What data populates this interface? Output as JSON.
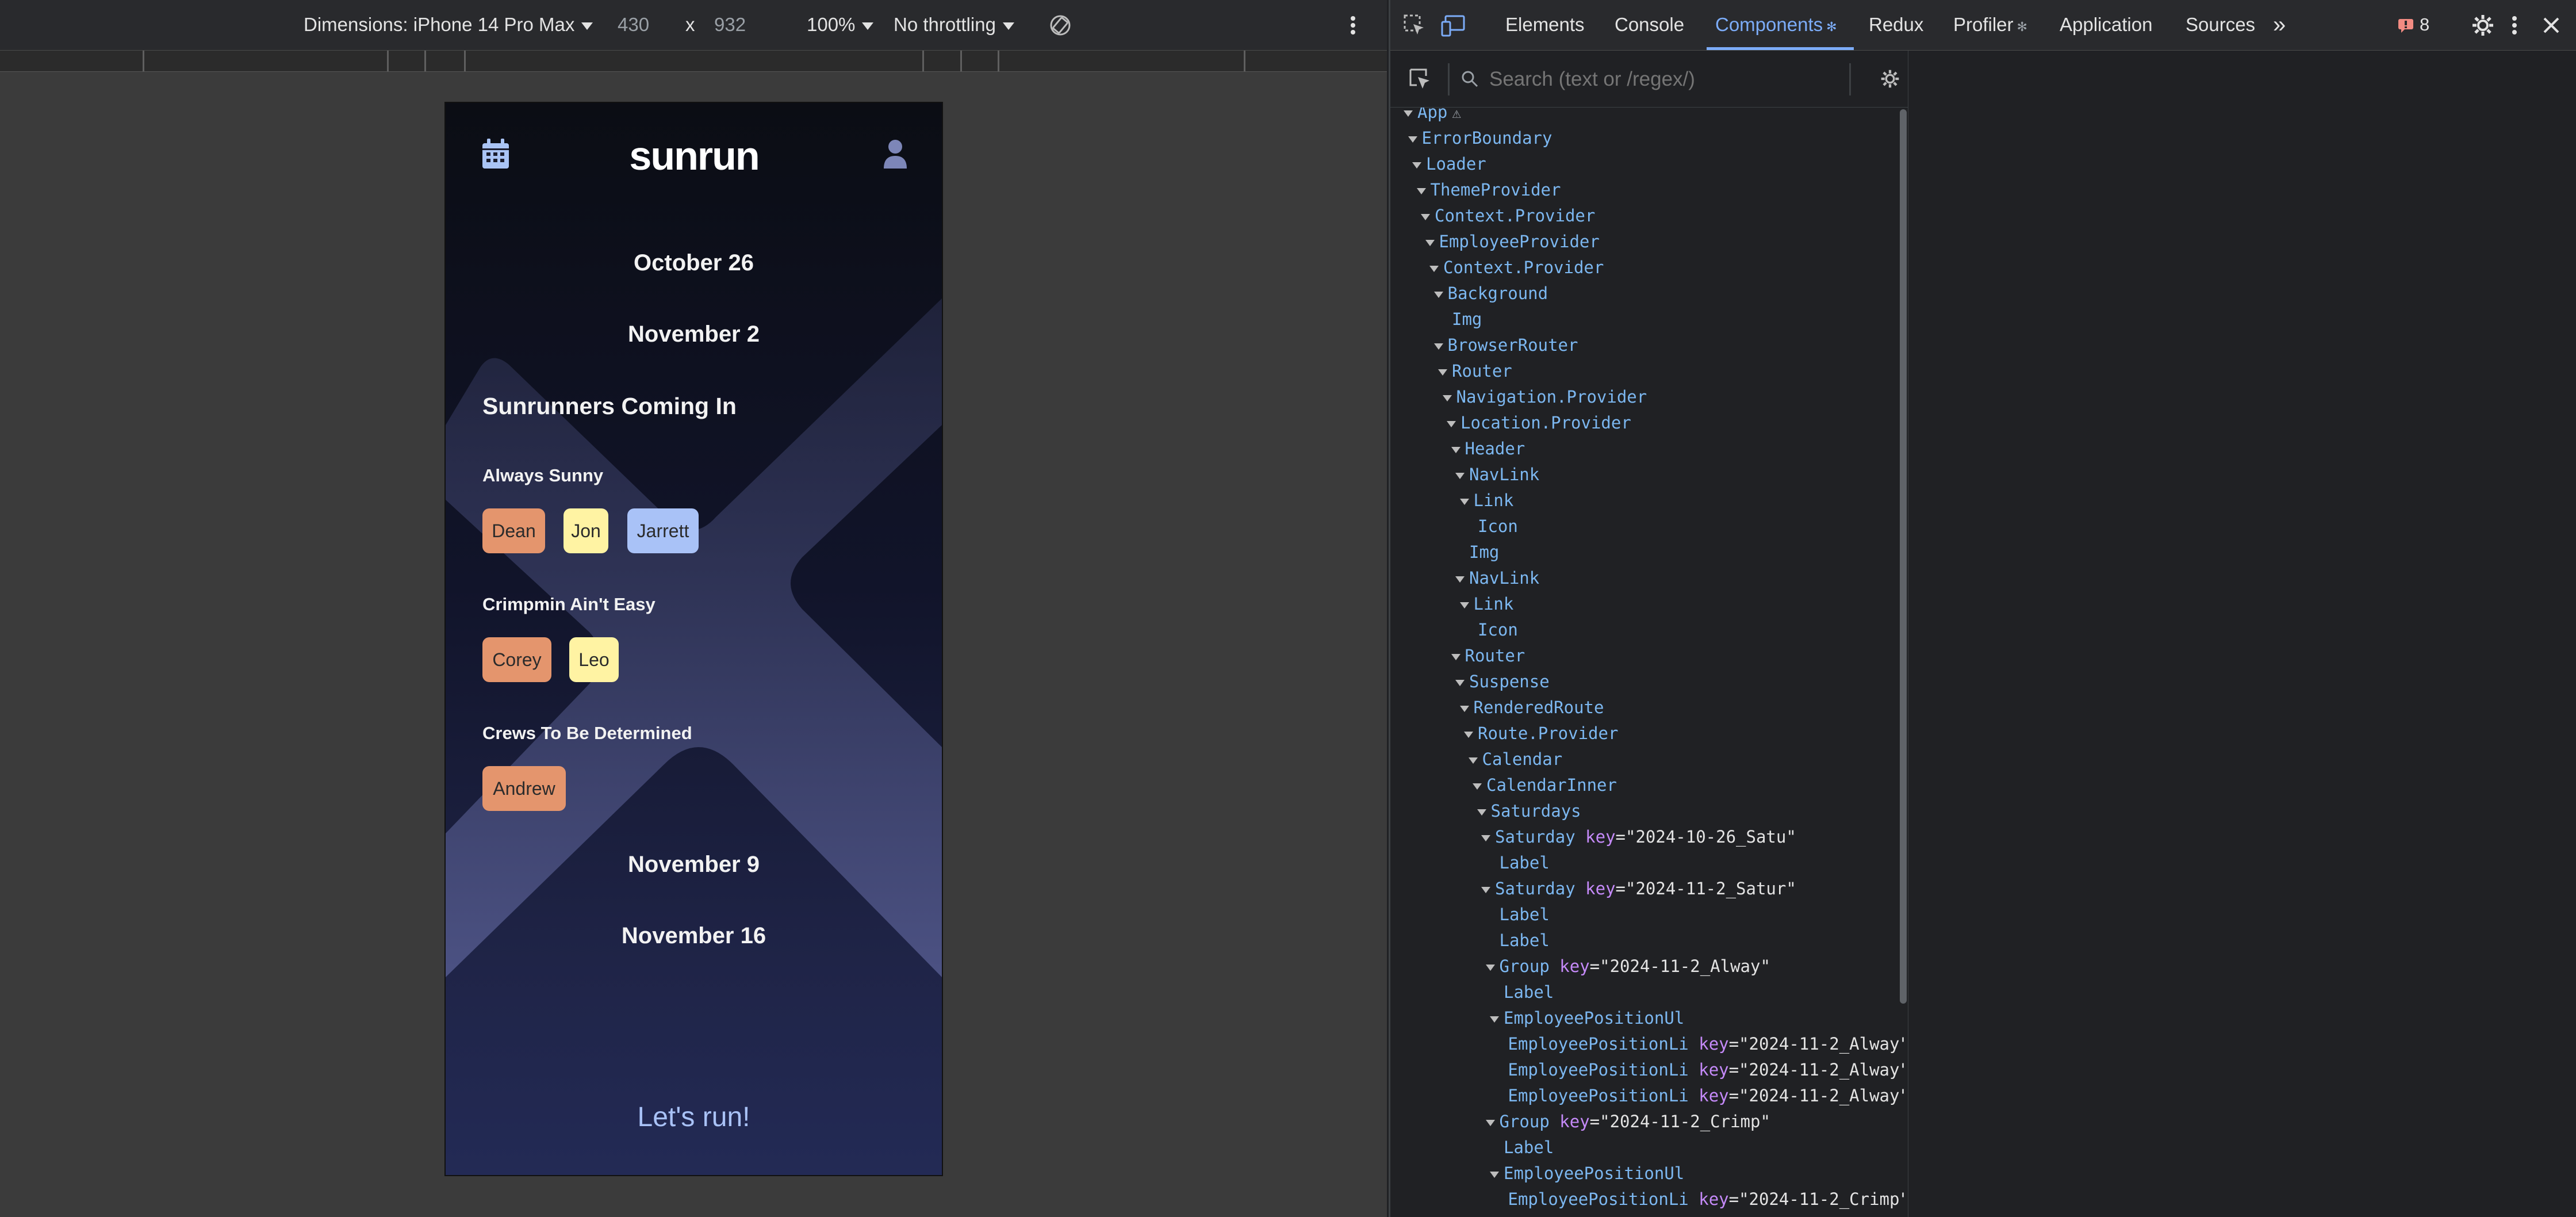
{
  "emulation_toolbar": {
    "dimensions_label": "Dimensions: iPhone 14 Pro Max",
    "width": "430",
    "times": "x",
    "height": "932",
    "zoom": "100%",
    "throttling": "No throttling"
  },
  "app": {
    "dates": [
      "October 26",
      "November 2",
      "November 9",
      "November 16"
    ],
    "section_title": "Sunrunners Coming In",
    "groups": [
      {
        "label": "Always Sunny",
        "members": [
          "Dean",
          "Jon",
          "Jarrett"
        ]
      },
      {
        "label": "Crimpmin Ain't Easy",
        "members": [
          "Corey",
          "Leo"
        ]
      },
      {
        "label": "Crews To Be Determined",
        "members": [
          "Andrew"
        ]
      }
    ],
    "cta": "Let's run!",
    "logo": "sunrun"
  },
  "devtools": {
    "tabs": [
      "Elements",
      "Console",
      "Components",
      "Redux",
      "Profiler",
      "Application",
      "Sources"
    ],
    "active_tab": "Components",
    "more_tabs": "»",
    "issues_count": "8",
    "search_placeholder": "Search (text or /regex/)",
    "tree": [
      {
        "name": "App",
        "warn": "⚠"
      },
      {
        "name": "ErrorBoundary"
      },
      {
        "name": "Loader"
      },
      {
        "name": "ThemeProvider"
      },
      {
        "name": "Context.Provider"
      },
      {
        "name": "EmployeeProvider"
      },
      {
        "name": "Context.Provider"
      },
      {
        "name": "Background"
      },
      {
        "name": "Img"
      },
      {
        "name": "BrowserRouter"
      },
      {
        "name": "Router"
      },
      {
        "name": "Navigation.Provider"
      },
      {
        "name": "Location.Provider"
      },
      {
        "name": "Header"
      },
      {
        "name": "NavLink"
      },
      {
        "name": "Link"
      },
      {
        "name": "Icon"
      },
      {
        "name": "Img"
      },
      {
        "name": "NavLink"
      },
      {
        "name": "Link"
      },
      {
        "name": "Icon"
      },
      {
        "name": "Router"
      },
      {
        "name": "Suspense"
      },
      {
        "name": "RenderedRoute"
      },
      {
        "name": "Route.Provider"
      },
      {
        "name": "Calendar"
      },
      {
        "name": "CalendarInner"
      },
      {
        "name": "Saturdays"
      },
      {
        "name": "Saturday",
        "key": "key",
        "val": "\"2024-10-26_Satu\""
      },
      {
        "name": "Label"
      },
      {
        "name": "Saturday",
        "key": "key",
        "val": "\"2024-11-2_Satur\""
      },
      {
        "name": "Label"
      },
      {
        "name": "Label"
      },
      {
        "name": "Group",
        "key": "key",
        "val": "\"2024-11-2_Alway\""
      },
      {
        "name": "Label"
      },
      {
        "name": "EmployeePositionUl"
      },
      {
        "name": "EmployeePositionLi",
        "key": "key",
        "val": "\"2024-11-2_Alway\""
      },
      {
        "name": "EmployeePositionLi",
        "key": "key",
        "val": "\"2024-11-2_Alway\""
      },
      {
        "name": "EmployeePositionLi",
        "key": "key",
        "val": "\"2024-11-2_Alway\""
      },
      {
        "name": "Group",
        "key": "key",
        "val": "\"2024-11-2_Crimp\""
      },
      {
        "name": "Label"
      },
      {
        "name": "EmployeePositionUl"
      },
      {
        "name": "EmployeePositionLi",
        "key": "key",
        "val": "\"2024-11-2_Crimp\""
      }
    ]
  }
}
